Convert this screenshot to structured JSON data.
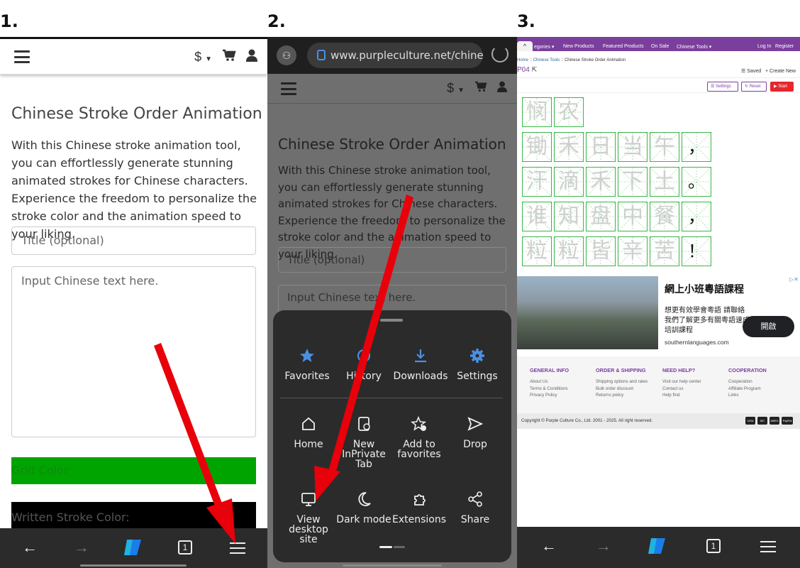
{
  "steps": {
    "one": "1.",
    "two": "2.",
    "three": "3."
  },
  "panel1": {
    "currency": "$",
    "title": "Chinese Stroke Order Animation",
    "description": "With this Chinese stroke animation tool, you can effortlessly generate stunning animated strokes for Chinese characters. Experience the freedom to personalize the stroke color and the animation speed to your liking.",
    "title_placeholder": "Title (optional)",
    "text_placeholder": "Input Chinese text here.",
    "grid_color_label": "Grid Color",
    "stroke_color_label": "Written Stroke Color:",
    "grid_color": "#00a400"
  },
  "panel2": {
    "url": "www.purpleculture.net/chinese-s",
    "currency": "$",
    "title": "Chinese Stroke Order Animation",
    "description": "With this Chinese stroke animation tool, you can effortlessly generate stunning animated strokes for Chinese characters. Experience the freedom to personalize the stroke color and the animation speed to your liking.",
    "title_placeholder": "Title (optional)",
    "text_placeholder": "Input Chinese text here.",
    "menu": {
      "favorites": "Favorites",
      "history": "History",
      "downloads": "Downloads",
      "settings": "Settings",
      "home": "Home",
      "new_inprivate": "New InPrivate Tab",
      "add_favorites": "Add to favorites",
      "drop": "Drop",
      "view_desktop": "View desktop site",
      "dark_mode": "Dark mode",
      "extensions": "Extensions",
      "share": "Share"
    }
  },
  "panel3": {
    "nav": {
      "categories": "egories ▾",
      "new_products": "New Products",
      "featured": "Featured Products",
      "on_sale": "On Sale",
      "chinese_tools": "Chinese Tools ▾",
      "login": "Log In",
      "register": "Register"
    },
    "breadcrumb": {
      "home": "Home",
      "tools": "Chinese Tools",
      "current": "Chinese Stroke Order Animation"
    },
    "product_id": "P04",
    "saved": "Saved",
    "create_new": "Create New",
    "buttons": {
      "settings": "Settings",
      "reset": "Reset",
      "start": "Start"
    },
    "rows": [
      [
        "悯",
        "农"
      ],
      [
        "锄",
        "禾",
        "日",
        "当",
        "午",
        "，"
      ],
      [
        "汗",
        "滴",
        "禾",
        "下",
        "土",
        "。"
      ],
      [
        "谁",
        "知",
        "盘",
        "中",
        "餐",
        "，"
      ],
      [
        "粒",
        "粒",
        "皆",
        "辛",
        "苦",
        "！"
      ]
    ],
    "ad": {
      "title": "網上小班粵語課程",
      "body": "想更有效學會粵語 請聯絡我們了解更多有關粵語速成培訓課程",
      "url": "southernlanguages.com",
      "button": "開啟"
    },
    "footer": {
      "col1": {
        "heading": "GENERAL INFO",
        "links": [
          "About Us",
          "Terms & Conditions",
          "Privacy Policy"
        ]
      },
      "col2": {
        "heading": "ORDER & SHIPPING",
        "links": [
          "Shipping options and rates",
          "Bulk order discount",
          "Returns policy"
        ]
      },
      "col3": {
        "heading": "NEED HELP?",
        "links": [
          "Visit our help center",
          "Contact us",
          "Help find"
        ]
      },
      "col4": {
        "heading": "COOPERATION",
        "links": [
          "Cooperation",
          "Affiliate Program",
          "Links"
        ]
      }
    },
    "copyright": "Copyright © Purple Culture Co., Ltd. 2001 - 2025. All right reserved.",
    "payments": [
      "VISA",
      "MC",
      "AMEX",
      "PayPal"
    ]
  },
  "bottom_nav": {
    "tab_count": "1"
  },
  "colors": {
    "arrow": "#e8000a",
    "brand_purple": "#7a3e9d",
    "grid_green": "#3bb54a",
    "menu_accent": "#4a90e2"
  }
}
